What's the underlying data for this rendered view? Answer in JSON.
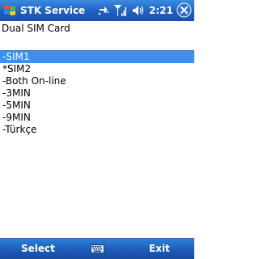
{
  "title_bar": {
    "title": "STK Service",
    "time": "2:21",
    "icons": [
      "start-flag-icon",
      "connectivity-icon",
      "signal-strength-icon",
      "volume-icon",
      "close-icon"
    ]
  },
  "prompt": "Dual SIM Card",
  "menu": {
    "selected_index": 0,
    "items": [
      {
        "label": "-SIM1"
      },
      {
        "label": "*SIM2"
      },
      {
        "label": "-Both On-line"
      },
      {
        "label": "-3MIN"
      },
      {
        "label": "-5MIN"
      },
      {
        "label": "-9MIN"
      },
      {
        "label": "-Türkçe"
      }
    ]
  },
  "softkeys": {
    "left": "Select",
    "right": "Exit"
  },
  "colors": {
    "title_bar": "#1f5fc2",
    "selection": "#3d8ff0",
    "menu_bar": "#1c58b8"
  }
}
